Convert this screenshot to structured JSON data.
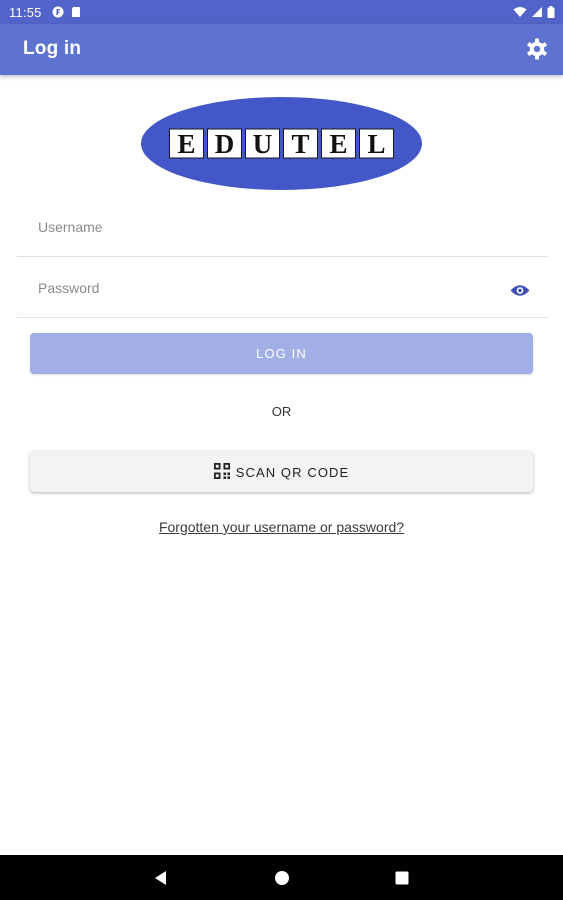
{
  "status_bar": {
    "time": "11:55"
  },
  "app_bar": {
    "title": "Log in",
    "settings_icon": "gear-icon"
  },
  "logo": {
    "letters": [
      "E",
      "D",
      "U",
      "T",
      "E",
      "L"
    ]
  },
  "form": {
    "username": {
      "value": "",
      "placeholder": "Username"
    },
    "password": {
      "value": "",
      "placeholder": "Password"
    },
    "login_label": "LOG IN",
    "or_text": "OR",
    "scan_qr_label": "SCAN QR CODE",
    "forgot_link": "Forgotten your username or password?"
  },
  "colors": {
    "status_bar": "#5264c9",
    "app_bar": "#5d73cf",
    "logo_ellipse": "#4357c8",
    "login_button_disabled": "#a2aee6",
    "eye_icon": "#3f51b5"
  },
  "nav_bar": {
    "back_icon": "back-triangle-icon",
    "home_icon": "home-circle-icon",
    "recents_icon": "recents-square-icon"
  }
}
